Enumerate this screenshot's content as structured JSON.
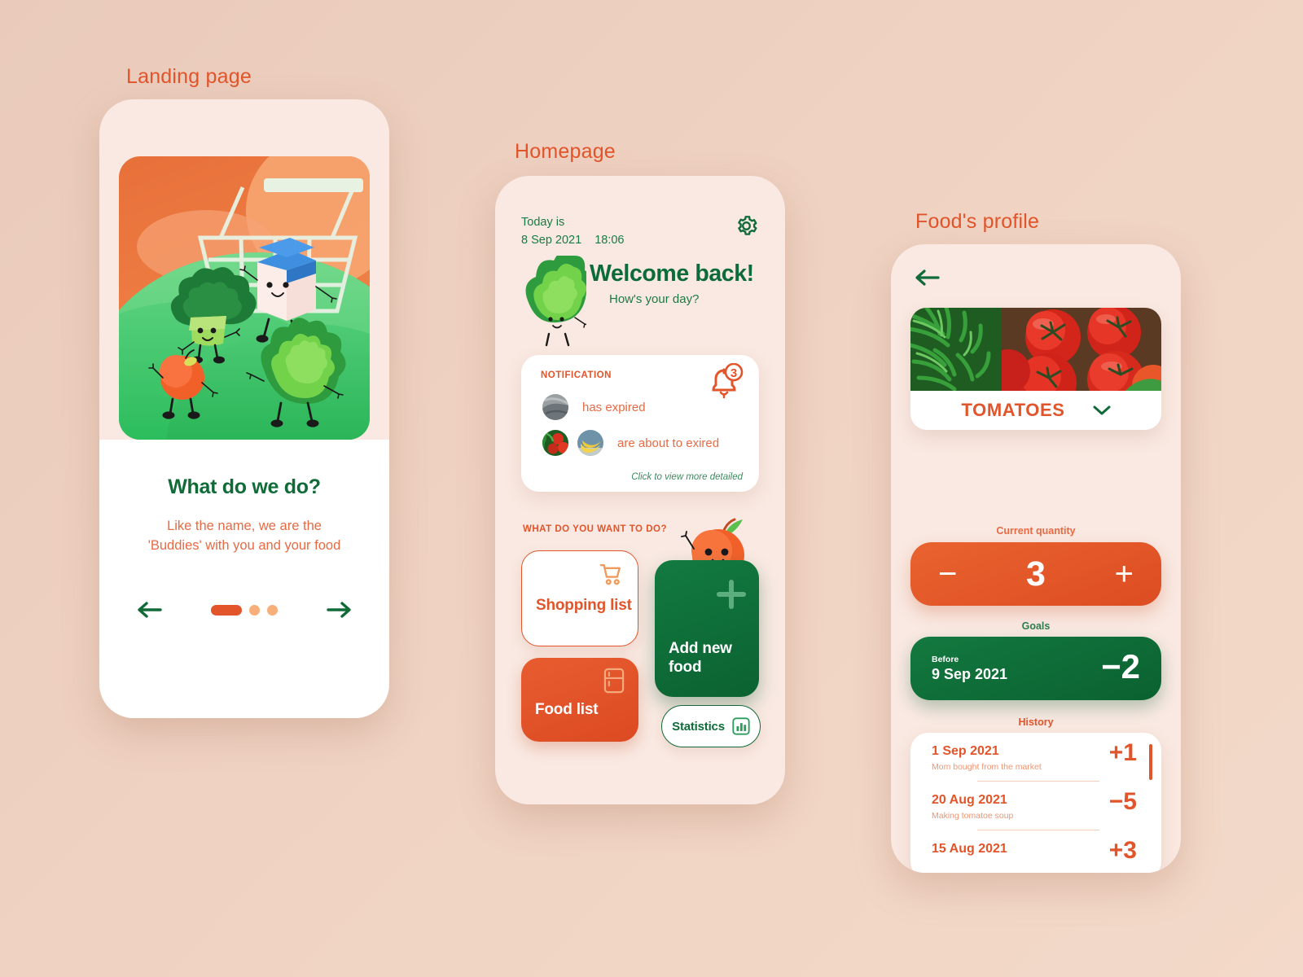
{
  "theme": {
    "orange": "#E2542A",
    "green": "#106B38",
    "bg": "#EDCEBF",
    "phone_bg": "#F9E9E2"
  },
  "captions": {
    "landing": "Landing page",
    "homepage": "Homepage",
    "profile": "Food's profile"
  },
  "landing": {
    "title": "What do we do?",
    "subtitle": "Like the name, we are the 'Buddies' with you and your food",
    "prev_label": "←",
    "next_label": "→",
    "dots": [
      {
        "active": true
      },
      {
        "active": false
      },
      {
        "active": false
      }
    ]
  },
  "homepage": {
    "today_label": "Today is",
    "date": "8 Sep 2021",
    "time": "18:06",
    "welcome_title": "Welcome back!",
    "welcome_sub": "How's your day?",
    "notification": {
      "heading": "NOTIFICATION",
      "badge_count": "3",
      "items": [
        {
          "text": "has expired",
          "thumbs": [
            "fish-thumbnail"
          ]
        },
        {
          "text": "are about to exired",
          "thumbs": [
            "tomatoes-thumbnail",
            "bananas-thumbnail"
          ]
        }
      ],
      "more_link": "Click to view more detailed"
    },
    "actions_heading": "WHAT DO YOU WANT TO DO?",
    "tiles": {
      "shopping_list": "Shopping list",
      "food_list": "Food list",
      "add_new_food": "Add new food",
      "statistics": "Statistics"
    }
  },
  "profile": {
    "food_name": "TOMATOES",
    "quantity_label": "Current quantity",
    "quantity_value": "3",
    "decrement_label": "−",
    "increment_label": "+",
    "goals_label": "Goals",
    "goal_before_label": "Before",
    "goal_date": "9 Sep 2021",
    "goal_delta": "−2",
    "history_label": "History",
    "history": [
      {
        "date": "1 Sep 2021",
        "note": "Mom bought from the market",
        "delta": "+1"
      },
      {
        "date": "20 Aug 2021",
        "note": "Making tomatoe soup",
        "delta": "−5"
      },
      {
        "date": "15 Aug 2021",
        "note": "",
        "delta": "+3"
      }
    ]
  }
}
